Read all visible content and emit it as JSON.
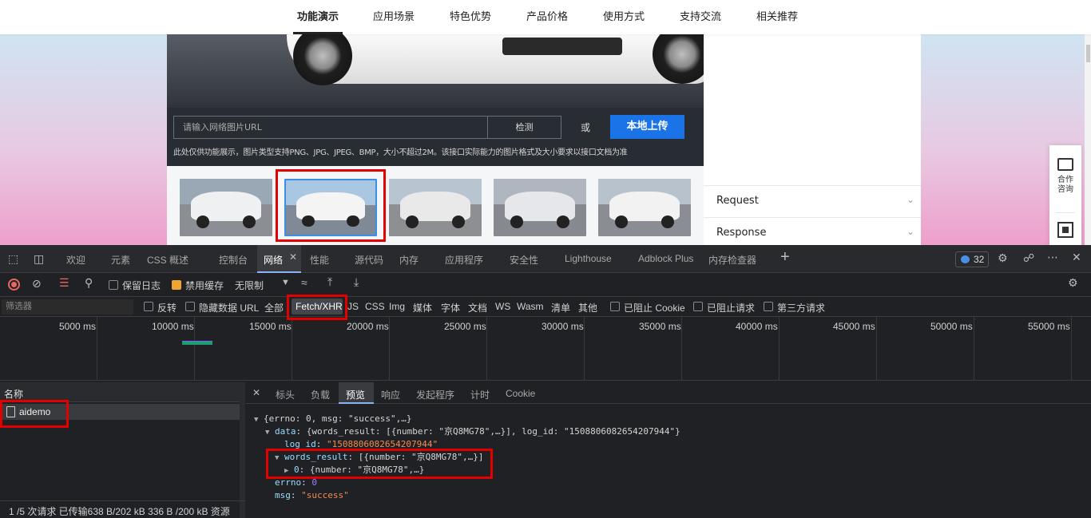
{
  "topnav": {
    "items": [
      "功能演示",
      "应用场景",
      "特色优势",
      "产品价格",
      "使用方式",
      "支持交流",
      "相关推荐"
    ]
  },
  "demo": {
    "url_placeholder": "请输入网络图片URL",
    "detect_label": "检测",
    "or_label": "或",
    "upload_label": "本地上传",
    "note": "此处仅供功能展示，图片类型支持PNG、JPG、JPEG、BMP，大小不超过2M。该接口实际能力的图片格式及大小要求以接口文档为准"
  },
  "side_panel": {
    "request_label": "Request",
    "response_label": "Response"
  },
  "float_button": {
    "label": "合作咨询"
  },
  "devtools": {
    "tabs": [
      "欢迎",
      "元素",
      "CSS 概述",
      "控制台",
      "网络",
      "性能",
      "源代码",
      "内存",
      "应用程序",
      "安全性",
      "Lighthouse",
      "Adblock Plus",
      "内存检查器"
    ],
    "active_tab": "网络",
    "issues_count": "32",
    "toolbar": {
      "preserve_log": "保留日志",
      "disable_cache": "禁用缓存",
      "throttle": "无限制"
    },
    "filter": {
      "placeholder": "筛选器",
      "invert": "反转",
      "hide_data_urls": "隐藏数据 URL",
      "types": [
        "全部",
        "Fetch/XHR",
        "JS",
        "CSS",
        "Img",
        "媒体",
        "字体",
        "文档",
        "WS",
        "Wasm",
        "清单",
        "其他"
      ],
      "active_type": "Fetch/XHR",
      "blocked_cookies": "已阻止 Cookie",
      "blocked_requests": "已阻止请求",
      "third_party": "第三方请求"
    },
    "timeline_labels": [
      "5000 ms",
      "10000 ms",
      "15000 ms",
      "20000 ms",
      "25000 ms",
      "30000 ms",
      "35000 ms",
      "40000 ms",
      "45000 ms",
      "50000 ms",
      "55000 ms"
    ],
    "requests": {
      "column_name": "名称",
      "rows": [
        "aidemo"
      ],
      "status": "1 /5 次请求  已传输638 B/202 kB  336 B /200 kB 资源"
    },
    "detail": {
      "tabs": [
        "标头",
        "负载",
        "预览",
        "响应",
        "发起程序",
        "计时",
        "Cookie"
      ],
      "active_tab": "预览",
      "preview": {
        "l1_summary": "{errno: 0, msg: \"success\",…}",
        "l2_key": "data",
        "l2_summary": "{words_result: [{number: \"京Q8MG78\",…}], log_id: \"1508806082654207944\"}",
        "l3_key": "log_id",
        "l3_val": "\"1508806082654207944\"",
        "l4_key": "words_result",
        "l4_summary": "[{number: \"京Q8MG78\",…}]",
        "l5_key": "0",
        "l5_summary": "{number: \"京Q8MG78\",…}",
        "l6_key": "errno",
        "l6_val": "0",
        "l7_key": "msg",
        "l7_val": "\"success\""
      }
    }
  }
}
